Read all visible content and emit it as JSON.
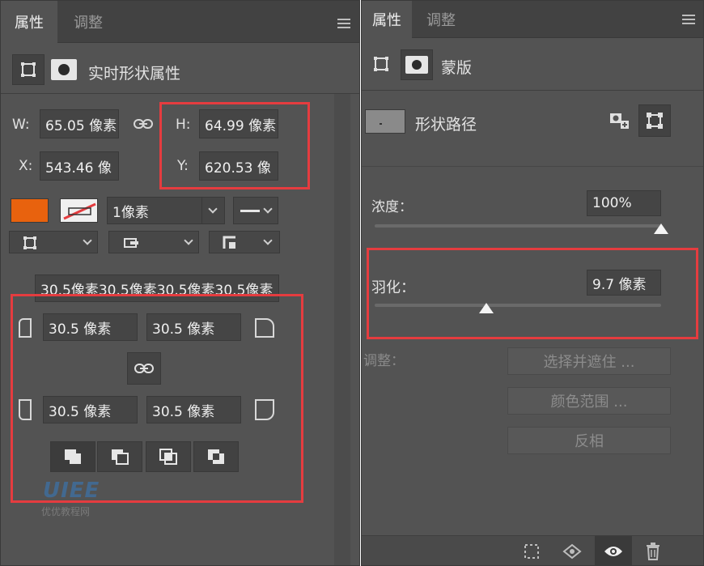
{
  "left_panel": {
    "tabs": [
      {
        "label": "属性"
      },
      {
        "label": "调整"
      }
    ],
    "header_label": "实时形状属性",
    "w_label": "W:",
    "w_value": "65.05 像素",
    "h_label": "H:",
    "h_value": "64.99 像素",
    "x_label": "X:",
    "x_value": "543.46 像",
    "y_label": "Y:",
    "y_value": "620.53 像",
    "fill_color": "#e8620e",
    "stroke_width": "1像素",
    "corner_summary": "30.5像素30.5像素30.5像素30.5像素",
    "corner_tl": "30.5 像素",
    "corner_tr": "30.5 像素",
    "corner_bl": "30.5 像素",
    "corner_br": "30.5 像素",
    "watermark": "优优教程网"
  },
  "right_panel": {
    "tabs": [
      {
        "label": "属性"
      },
      {
        "label": "调整"
      }
    ],
    "header_label": "蒙版",
    "shape_path_label": "形状路径",
    "density_label": "浓度：",
    "density_value": "100%",
    "density_level": 1.0,
    "feather_label": "羽化：",
    "feather_value": "9.7 像素",
    "feather_level": 0.39,
    "adjust_label": "调整：",
    "btn_select_mask": "选择并遮住 ...",
    "btn_color_range": "颜色范围 ...",
    "btn_invert": "反相"
  },
  "colors": {
    "highlight": "#e53c3f",
    "panel_bg": "#535353",
    "fill_swatch": "#e8620e"
  }
}
